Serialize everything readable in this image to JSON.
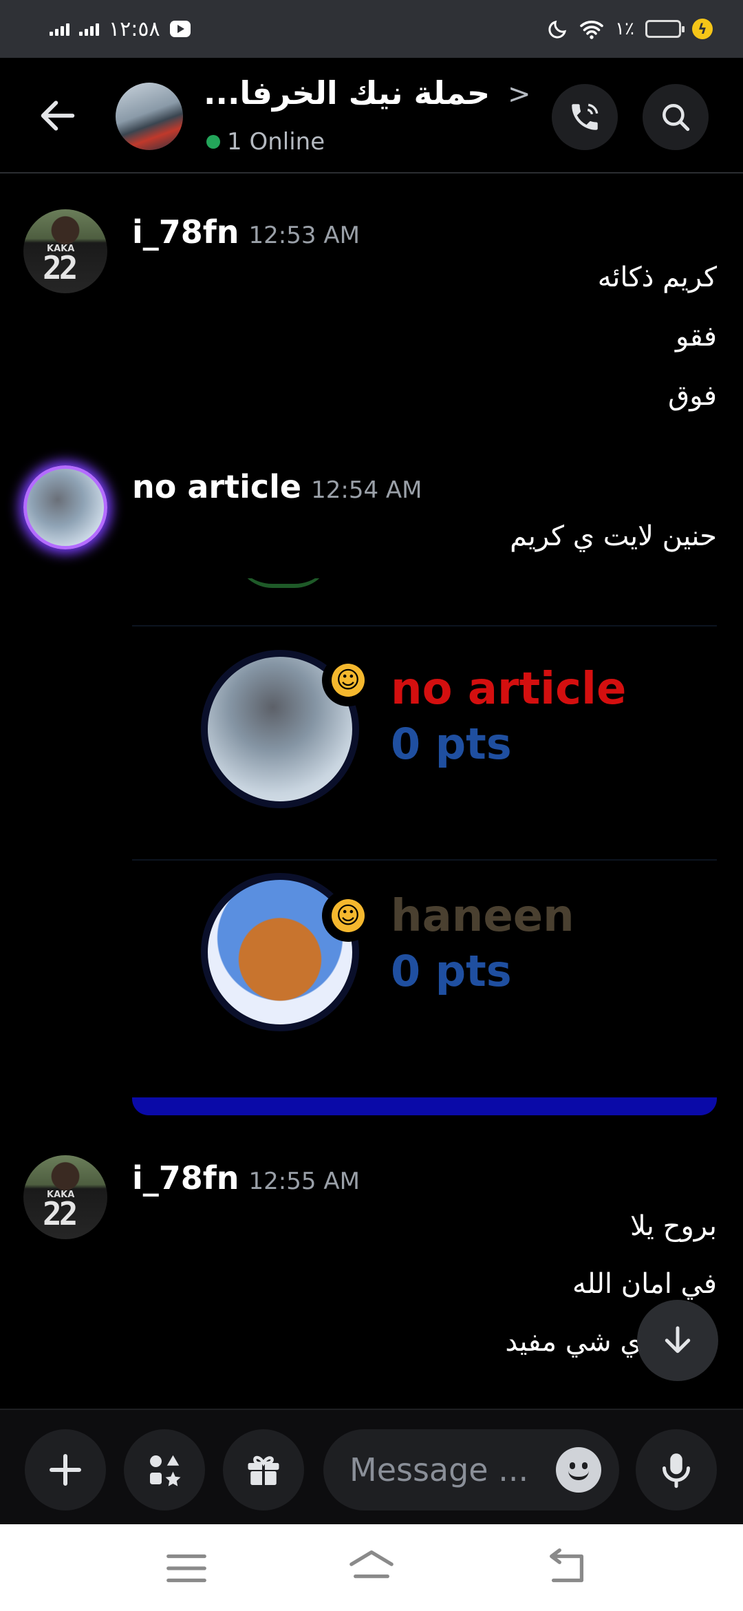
{
  "status_bar": {
    "time": "١٢:٥٨",
    "battery": "١٪"
  },
  "header": {
    "channel_name": "حملة نيك الخرفا...",
    "online_status": "1 Online"
  },
  "messages": [
    {
      "username": "i_78fn",
      "time": "12:53 AM",
      "avatar_text": "22",
      "avatar_name": "KAKA",
      "lines": [
        "كريم ذكائه",
        "فقو",
        "فوق"
      ]
    },
    {
      "username": "no article",
      "time": "12:54 AM",
      "lines": [
        "حنين لايت ي كريم"
      ]
    },
    {
      "username": "i_78fn",
      "time": "12:55 AM",
      "avatar_text": "22",
      "avatar_name": "KAKA",
      "lines": [
        "بروح يلا",
        "في امان الله",
        "سوي اي شي مفيد"
      ]
    }
  ],
  "leaderboard": [
    {
      "name": "no article",
      "points": "0 pts",
      "name_color": "#d40f0f"
    },
    {
      "name": "haneen",
      "points": "0 pts",
      "name_color": "#4a4030"
    }
  ],
  "composer": {
    "placeholder": "Message ..."
  },
  "colors": {
    "online_dot": "#23a55a",
    "points_blue": "#1f4fa0",
    "embed_bar": "#0a0aa8"
  }
}
